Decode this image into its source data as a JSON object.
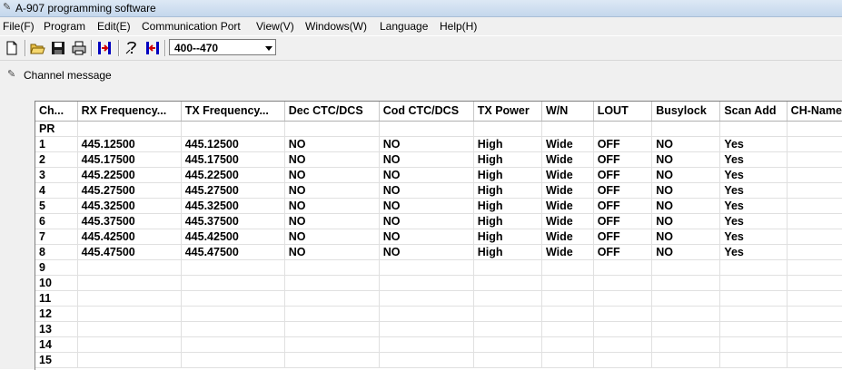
{
  "window": {
    "title": "A-907 programming software"
  },
  "menu": [
    "File(F)",
    "Program",
    "Edit(E)",
    "Communication Port",
    "View(V)",
    "Windows(W)",
    "Language",
    "Help(H)"
  ],
  "toolbar": {
    "band_select": "400--470",
    "icons": [
      "new-file-icon",
      "open-folder-icon",
      "save-icon",
      "print-icon",
      "read-radio-icon",
      "help-icon",
      "write-radio-icon"
    ]
  },
  "child_window": {
    "title": "Channel message"
  },
  "table": {
    "columns": [
      "Ch...",
      "RX Frequency...",
      "TX Frequency...",
      "Dec CTC/DCS",
      "Cod CTC/DCS",
      "TX Power",
      "W/N",
      "LOUT",
      "Busylock",
      "Scan Add",
      "CH-Name"
    ],
    "rows": [
      [
        "PR",
        "",
        "",
        "",
        "",
        "",
        "",
        "",
        "",
        "",
        ""
      ],
      [
        "1",
        "445.12500",
        "445.12500",
        "NO",
        "NO",
        "High",
        "Wide",
        "OFF",
        "NO",
        "Yes",
        ""
      ],
      [
        "2",
        "445.17500",
        "445.17500",
        "NO",
        "NO",
        "High",
        "Wide",
        "OFF",
        "NO",
        "Yes",
        ""
      ],
      [
        "3",
        "445.22500",
        "445.22500",
        "NO",
        "NO",
        "High",
        "Wide",
        "OFF",
        "NO",
        "Yes",
        ""
      ],
      [
        "4",
        "445.27500",
        "445.27500",
        "NO",
        "NO",
        "High",
        "Wide",
        "OFF",
        "NO",
        "Yes",
        ""
      ],
      [
        "5",
        "445.32500",
        "445.32500",
        "NO",
        "NO",
        "High",
        "Wide",
        "OFF",
        "NO",
        "Yes",
        ""
      ],
      [
        "6",
        "445.37500",
        "445.37500",
        "NO",
        "NO",
        "High",
        "Wide",
        "OFF",
        "NO",
        "Yes",
        ""
      ],
      [
        "7",
        "445.42500",
        "445.42500",
        "NO",
        "NO",
        "High",
        "Wide",
        "OFF",
        "NO",
        "Yes",
        ""
      ],
      [
        "8",
        "445.47500",
        "445.47500",
        "NO",
        "NO",
        "High",
        "Wide",
        "OFF",
        "NO",
        "Yes",
        ""
      ],
      [
        "9",
        "",
        "",
        "",
        "",
        "",
        "",
        "",
        "",
        "",
        ""
      ],
      [
        "10",
        "",
        "",
        "",
        "",
        "",
        "",
        "",
        "",
        "",
        ""
      ],
      [
        "11",
        "",
        "",
        "",
        "",
        "",
        "",
        "",
        "",
        "",
        ""
      ],
      [
        "12",
        "",
        "",
        "",
        "",
        "",
        "",
        "",
        "",
        "",
        ""
      ],
      [
        "13",
        "",
        "",
        "",
        "",
        "",
        "",
        "",
        "",
        "",
        ""
      ],
      [
        "14",
        "",
        "",
        "",
        "",
        "",
        "",
        "",
        "",
        "",
        ""
      ],
      [
        "15",
        "",
        "",
        "",
        "",
        "",
        "",
        "",
        "",
        "",
        ""
      ]
    ]
  }
}
